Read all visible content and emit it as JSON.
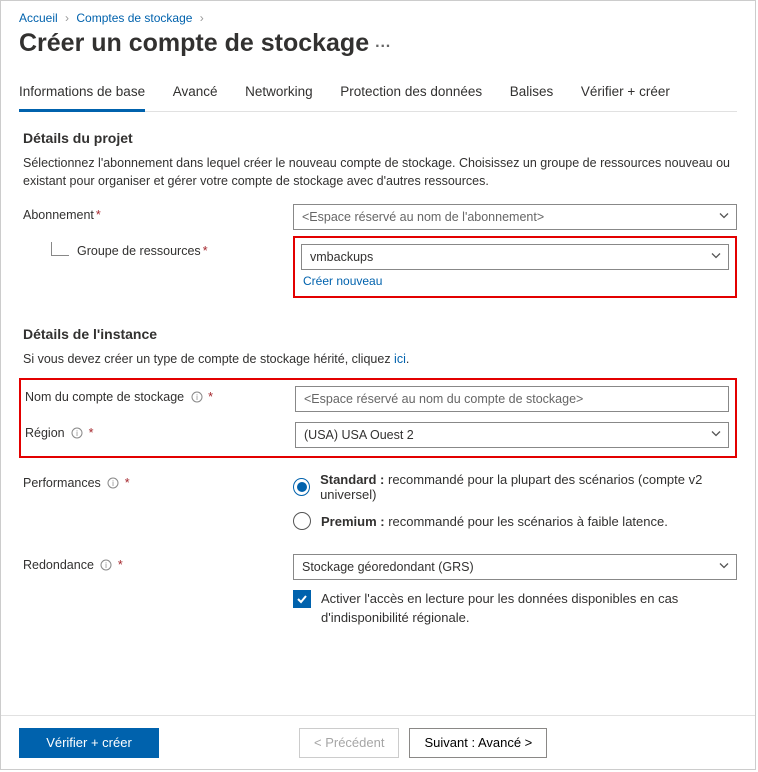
{
  "breadcrumbs": {
    "home": "Accueil",
    "storage": "Comptes de stockage"
  },
  "page_title": "Créer un compte de stockage",
  "tabs": {
    "basics": "Informations de base",
    "advanced": "Avancé",
    "networking": "Networking",
    "data_protection": "Protection des données",
    "tags": "Balises",
    "review": "Vérifier + créer"
  },
  "project_details": {
    "heading": "Détails du projet",
    "description": "Sélectionnez l'abonnement dans lequel créer le nouveau compte de stockage. Choisissez un groupe de ressources nouveau ou existant pour organiser et gérer votre compte de stockage avec d'autres ressources.",
    "subscription_label": "Abonnement",
    "subscription_value": "<Espace réservé au nom de l'abonnement>",
    "resource_group_label": "Groupe de ressources",
    "resource_group_value": "vmbackups",
    "create_new": "Créer nouveau"
  },
  "instance_details": {
    "heading": "Détails de l'instance",
    "description_prefix": "Si vous devez créer un type de compte de stockage hérité, cliquez ",
    "description_link": "ici",
    "name_label": "Nom du compte de stockage",
    "name_placeholder": "<Espace réservé au nom du compte de stockage>",
    "region_label": "Région",
    "region_value": "(USA) USA Ouest 2",
    "performance_label": "Performances",
    "perf_standard_bold": "Standard :",
    "perf_standard_rest": " recommandé pour la plupart des scénarios (compte v2 universel)",
    "perf_premium_bold": "Premium :",
    "perf_premium_rest": " recommandé pour les scénarios à faible latence.",
    "redundancy_label": "Redondance",
    "redundancy_value": "Stockage géoredondant (GRS)",
    "ra_checkbox_label": "Activer l'accès en lecture pour les données disponibles en cas d'indisponibilité régionale."
  },
  "footer": {
    "review": "Vérifier + créer",
    "previous": "<  Précédent",
    "next": "Suivant : Avancé  >"
  }
}
